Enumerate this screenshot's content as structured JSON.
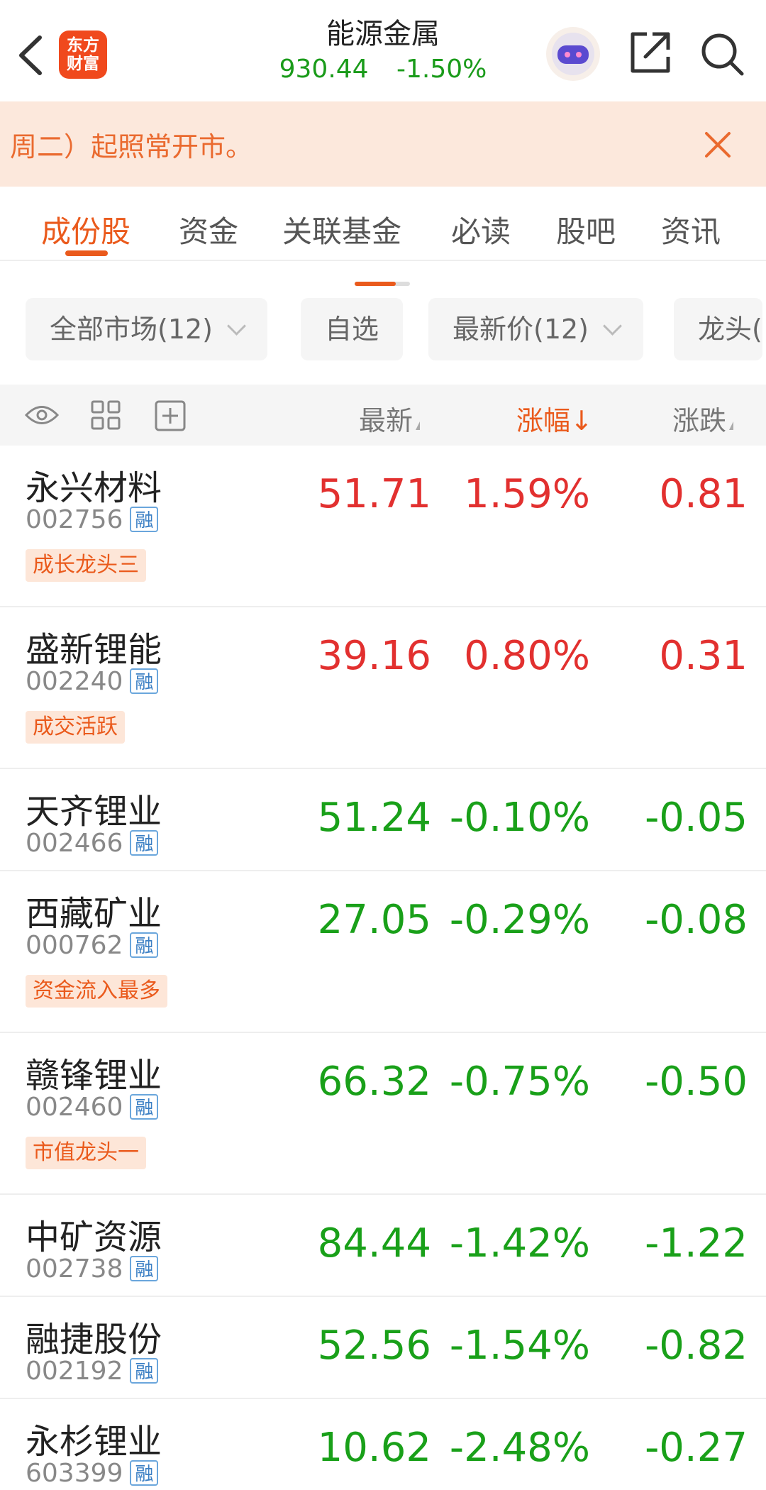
{
  "header": {
    "title": "能源金属",
    "price": "930.44",
    "change_pct": "-1.50%",
    "logo_line1": "东方",
    "logo_line2": "财富"
  },
  "notice": {
    "text": "周二）起照常开市。"
  },
  "tabs": [
    {
      "label": "成份股",
      "active": true
    },
    {
      "label": "资金"
    },
    {
      "label": "关联基金"
    },
    {
      "label": "必读"
    },
    {
      "label": "股吧"
    },
    {
      "label": "资讯"
    }
  ],
  "filters": {
    "market": "全部市场(12)",
    "watchlist": "自选",
    "latest_price": "最新价(12)",
    "leader": "龙头("
  },
  "table_header": {
    "latest": "最新",
    "change_pct": "涨幅",
    "sort_arrow": "↓",
    "change": "涨跌"
  },
  "rows": [
    {
      "name": "永兴材料",
      "code": "002756",
      "badge": "融",
      "tag": "成长龙头三",
      "price": "51.71",
      "pct": "1.59%",
      "chg": "0.81",
      "dir": "up"
    },
    {
      "name": "盛新锂能",
      "code": "002240",
      "badge": "融",
      "tag": "成交活跃",
      "price": "39.16",
      "pct": "0.80%",
      "chg": "0.31",
      "dir": "up"
    },
    {
      "name": "天齐锂业",
      "code": "002466",
      "badge": "融",
      "tag": "",
      "price": "51.24",
      "pct": "-0.10%",
      "chg": "-0.05",
      "dir": "down"
    },
    {
      "name": "西藏矿业",
      "code": "000762",
      "badge": "融",
      "tag": "资金流入最多",
      "price": "27.05",
      "pct": "-0.29%",
      "chg": "-0.08",
      "dir": "down"
    },
    {
      "name": "赣锋锂业",
      "code": "002460",
      "badge": "融",
      "tag": "市值龙头一",
      "price": "66.32",
      "pct": "-0.75%",
      "chg": "-0.50",
      "dir": "down"
    },
    {
      "name": "中矿资源",
      "code": "002738",
      "badge": "融",
      "tag": "",
      "price": "84.44",
      "pct": "-1.42%",
      "chg": "-1.22",
      "dir": "down"
    },
    {
      "name": "融捷股份",
      "code": "002192",
      "badge": "融",
      "tag": "",
      "price": "52.56",
      "pct": "-1.54%",
      "chg": "-0.82",
      "dir": "down"
    },
    {
      "name": "永杉锂业",
      "code": "603399",
      "badge": "融",
      "tag": "",
      "price": "10.62",
      "pct": "-2.48%",
      "chg": "-0.27",
      "dir": "down"
    }
  ],
  "colors": {
    "accent": "#ea5a1c",
    "up": "#e2302f",
    "down": "#19a019",
    "notice_bg": "#fce8dc"
  }
}
